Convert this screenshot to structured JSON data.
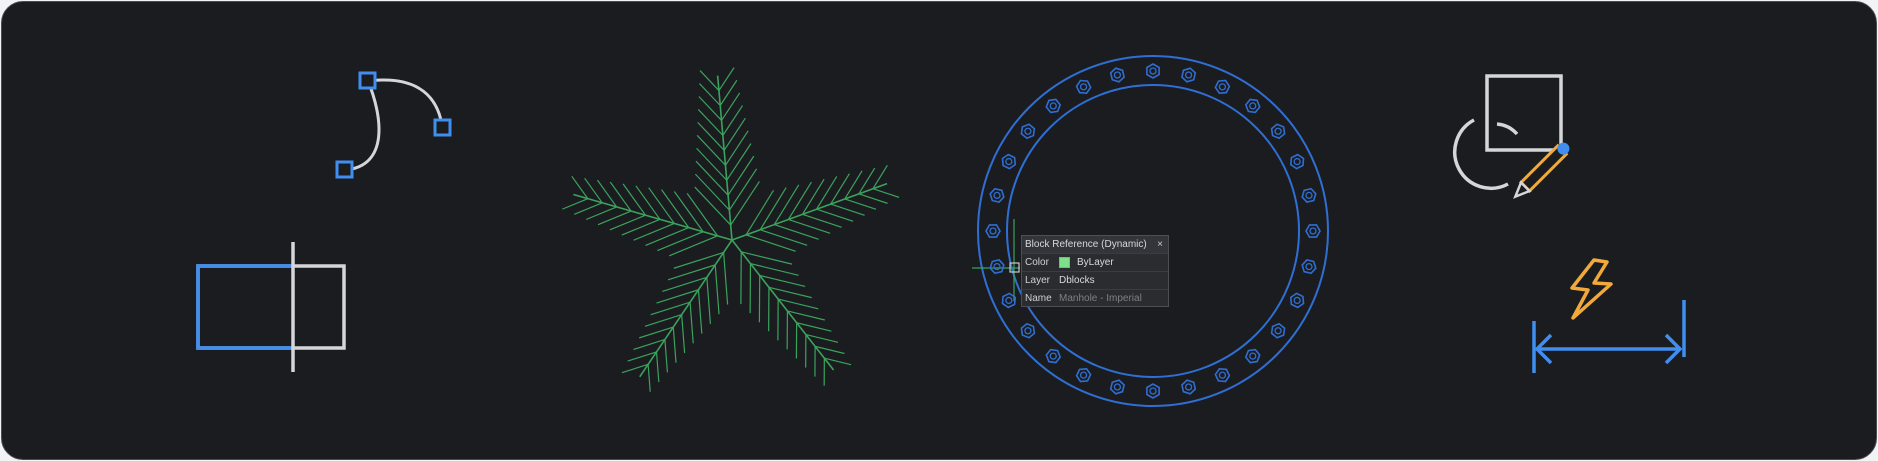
{
  "colors": {
    "background": "#1b1c1f",
    "accent_blue": "#3f8ef0",
    "light_gray": "#d4d6da",
    "tree_green": "#3aa35c",
    "lightning_orange": "#f0a93a",
    "swatch_green": "#7fe08a"
  },
  "icons": [
    "bezier-curve-icon",
    "trim-rectangle-icon",
    "tree-block-icon",
    "manhole-block-icon",
    "shape-edit-icon",
    "quick-dimension-icon"
  ],
  "tooltip": {
    "title": "Block Reference (Dynamic)",
    "close_symbol": "×",
    "rows": [
      {
        "key": "Color",
        "value": "ByLayer"
      },
      {
        "key": "Layer",
        "value": "Dblocks"
      },
      {
        "key": "Name",
        "value": "Manhole - Imperial"
      }
    ]
  }
}
